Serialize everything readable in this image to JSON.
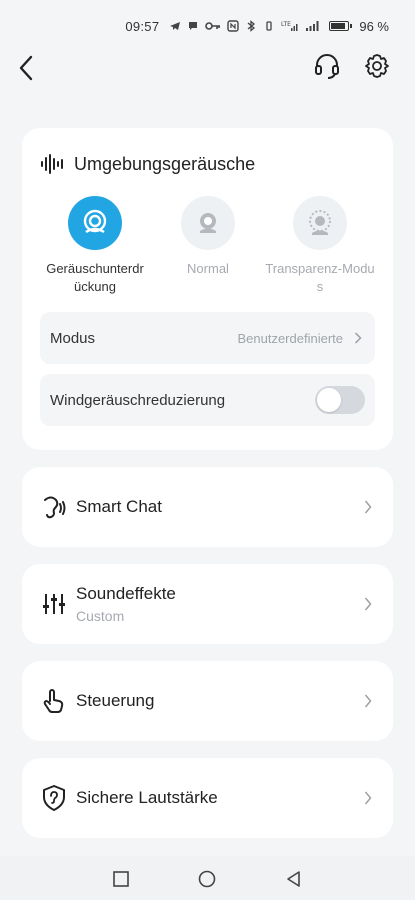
{
  "status_bar": {
    "time": "09:57",
    "battery": "96 %",
    "network": "LTE"
  },
  "topnav": {
    "icons": [
      "back-arrow-icon",
      "headset-icon",
      "gear-icon"
    ]
  },
  "noise": {
    "title": "Umgebungsgeräusche",
    "modes": [
      {
        "label": "Geräuschunterdr ückung",
        "active": true
      },
      {
        "label": "Normal",
        "active": false
      },
      {
        "label": "Transparenz-Modu s",
        "active": false
      }
    ],
    "modus_label": "Modus",
    "modus_value": "Benutzerdefinierte",
    "wind_label": "Windgeräuschreduzierung",
    "wind_enabled": false
  },
  "menu": {
    "smart_chat": "Smart Chat",
    "sound_effects": "Soundeffekte",
    "sound_effects_sub": "Custom",
    "control": "Steuerung",
    "safe_volume": "Sichere Lautstärke"
  },
  "colors": {
    "accent": "#21a6e3",
    "background": "#f3f5f7"
  }
}
